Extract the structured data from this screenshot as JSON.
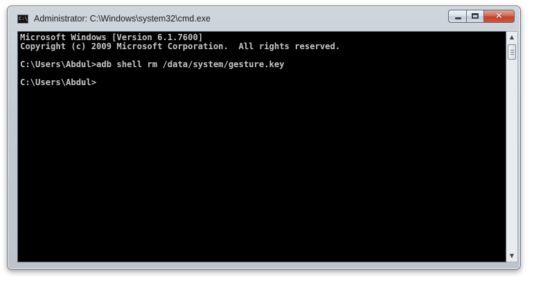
{
  "window": {
    "title": "Administrator: C:\\Windows\\system32\\cmd.exe",
    "icon_name": "cmd-icon",
    "icon_text": "C:\\"
  },
  "controls": {
    "minimize_icon": "minimize-icon",
    "maximize_icon": "maximize-icon",
    "close_icon": "close-icon",
    "close_glyph": "✕"
  },
  "console": {
    "lines": [
      "Microsoft Windows [Version 6.1.7600]",
      "Copyright (c) 2009 Microsoft Corporation.  All rights reserved.",
      "",
      "C:\\Users\\Abdul>adb shell rm /data/system/gesture.key",
      "",
      "C:\\Users\\Abdul>"
    ],
    "background": "#000000",
    "text_color": "#c6c6c6"
  },
  "scrollbar": {
    "up_glyph": "▲",
    "down_glyph": "▼"
  },
  "colors": {
    "close_button": "#c5402a",
    "frame": "#c3cad2"
  }
}
